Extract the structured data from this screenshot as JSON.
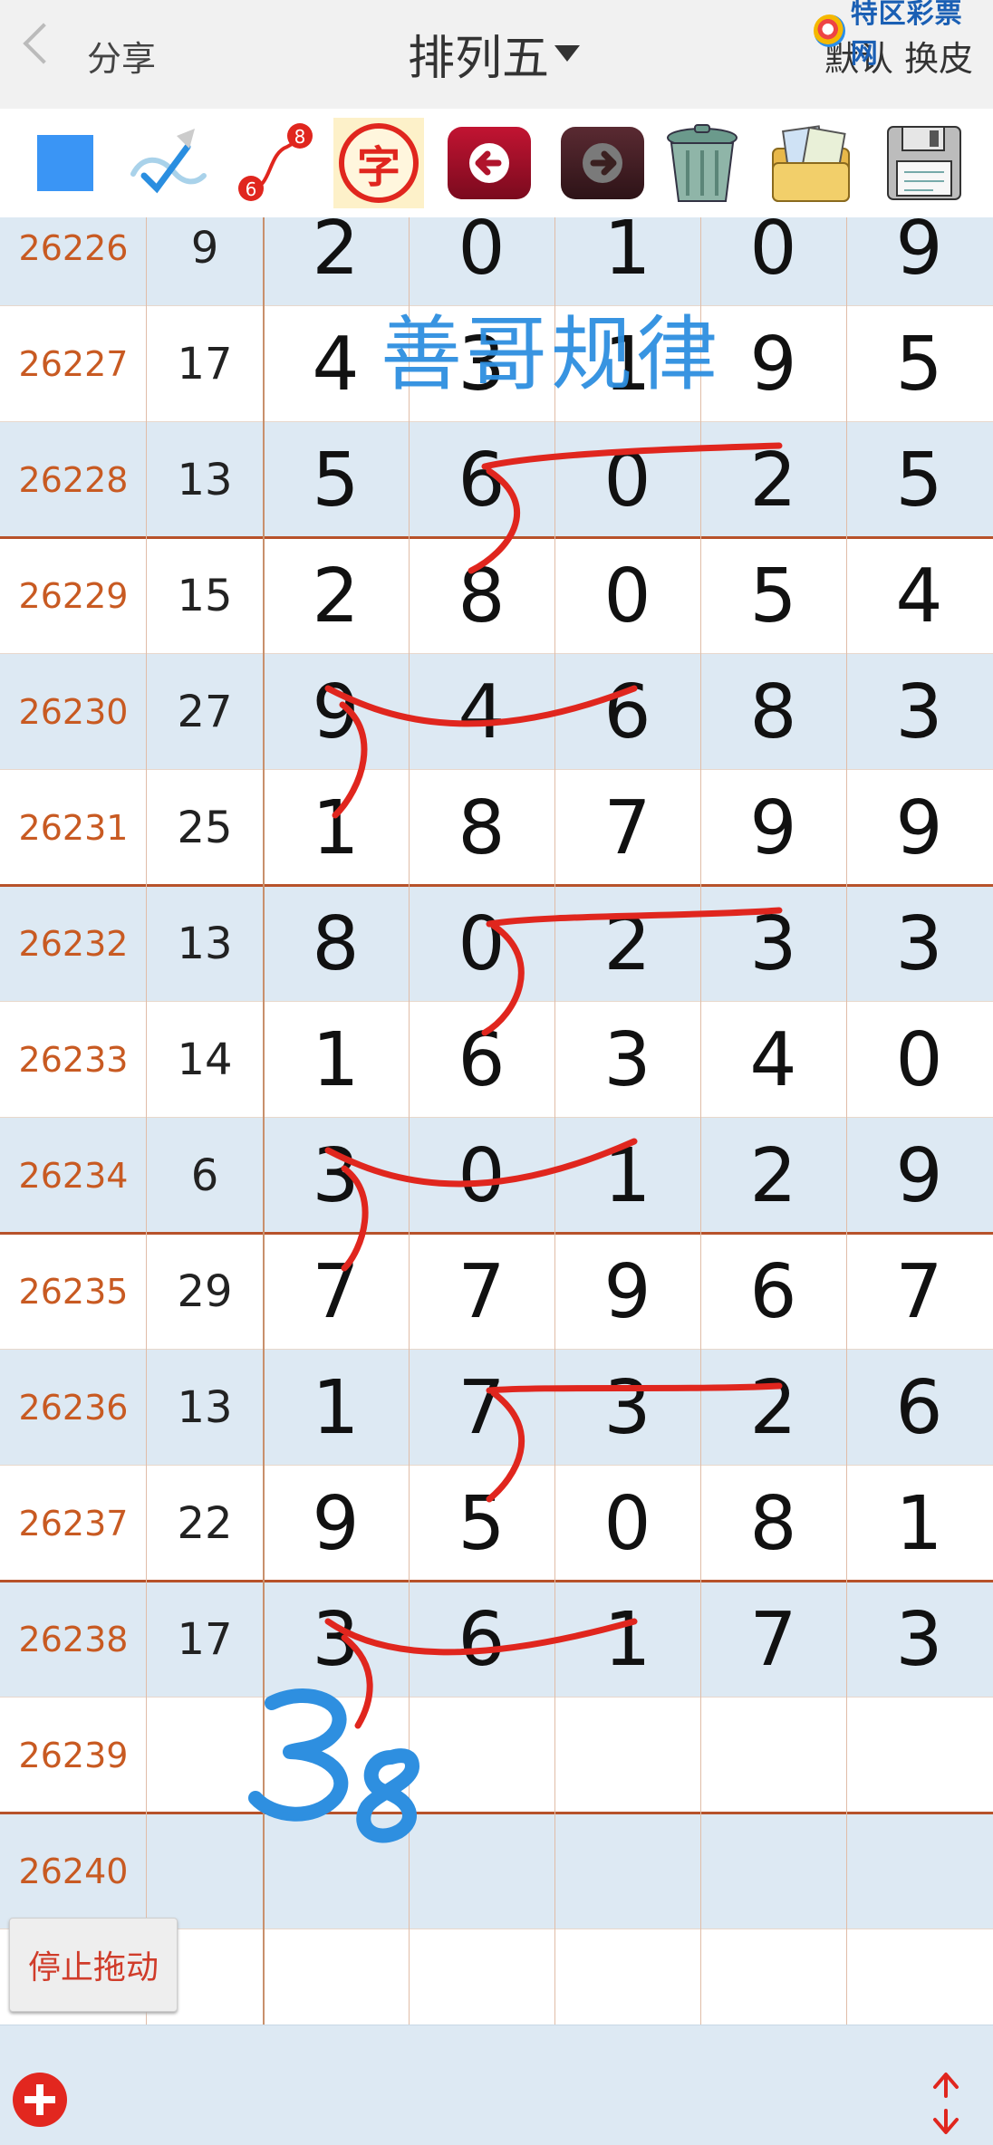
{
  "header": {
    "back_label": "分享",
    "title": "排列五",
    "skin_label": "默认 换皮",
    "brand": "特区彩票网"
  },
  "toolbar": {
    "tools": [
      {
        "name": "color-square",
        "icon": "blue-square-icon"
      },
      {
        "name": "pen",
        "icon": "pen-check-icon"
      },
      {
        "name": "connect-path",
        "icon": "path-6-8-icon",
        "from": "6",
        "to": "8"
      },
      {
        "name": "text",
        "icon": "char-icon",
        "label": "字"
      },
      {
        "name": "undo",
        "icon": "arrow-left-icon"
      },
      {
        "name": "redo",
        "icon": "arrow-right-icon"
      },
      {
        "name": "clear",
        "icon": "trash-icon"
      },
      {
        "name": "open",
        "icon": "folder-photos-icon"
      },
      {
        "name": "save",
        "icon": "floppy-disk-icon"
      }
    ],
    "accent_color": "#3a95f5"
  },
  "table": {
    "rows": [
      {
        "issue": "26226",
        "sum": "9",
        "digits": [
          "2",
          "0",
          "1",
          "0",
          "9"
        ]
      },
      {
        "issue": "26227",
        "sum": "17",
        "digits": [
          "4",
          "3",
          "1",
          "9",
          "5"
        ]
      },
      {
        "issue": "26228",
        "sum": "13",
        "digits": [
          "5",
          "6",
          "0",
          "2",
          "5"
        ]
      },
      {
        "issue": "26229",
        "sum": "15",
        "digits": [
          "2",
          "8",
          "0",
          "5",
          "4"
        ]
      },
      {
        "issue": "26230",
        "sum": "27",
        "digits": [
          "9",
          "4",
          "6",
          "8",
          "3"
        ]
      },
      {
        "issue": "26231",
        "sum": "25",
        "digits": [
          "1",
          "8",
          "7",
          "9",
          "9"
        ]
      },
      {
        "issue": "26232",
        "sum": "13",
        "digits": [
          "8",
          "0",
          "2",
          "3",
          "3"
        ]
      },
      {
        "issue": "26233",
        "sum": "14",
        "digits": [
          "1",
          "6",
          "3",
          "4",
          "0"
        ]
      },
      {
        "issue": "26234",
        "sum": "6",
        "digits": [
          "3",
          "0",
          "1",
          "2",
          "9"
        ]
      },
      {
        "issue": "26235",
        "sum": "29",
        "digits": [
          "7",
          "7",
          "9",
          "6",
          "7"
        ]
      },
      {
        "issue": "26236",
        "sum": "13",
        "digits": [
          "1",
          "7",
          "3",
          "2",
          "6"
        ]
      },
      {
        "issue": "26237",
        "sum": "22",
        "digits": [
          "9",
          "5",
          "0",
          "8",
          "1"
        ]
      },
      {
        "issue": "26238",
        "sum": "17",
        "digits": [
          "3",
          "6",
          "1",
          "7",
          "3"
        ]
      },
      {
        "issue": "26239",
        "sum": "",
        "digits": [
          "",
          "",
          "",
          "",
          ""
        ]
      },
      {
        "issue": "26240",
        "sum": "",
        "digits": [
          "",
          "",
          "",
          "",
          ""
        ]
      }
    ],
    "issue_color": "#c85a22",
    "stripe_color": "#dde9f3"
  },
  "annotations": {
    "watermark": "善哥规律",
    "prediction": "38",
    "stroke_color": "#e0261e",
    "prediction_color": "#2e8fe0"
  },
  "controls": {
    "stop_drag_label": "停止拖动"
  },
  "bottom": {
    "add_icon": "plus-circle-icon",
    "resize_icon": "vertical-resize-icon"
  }
}
